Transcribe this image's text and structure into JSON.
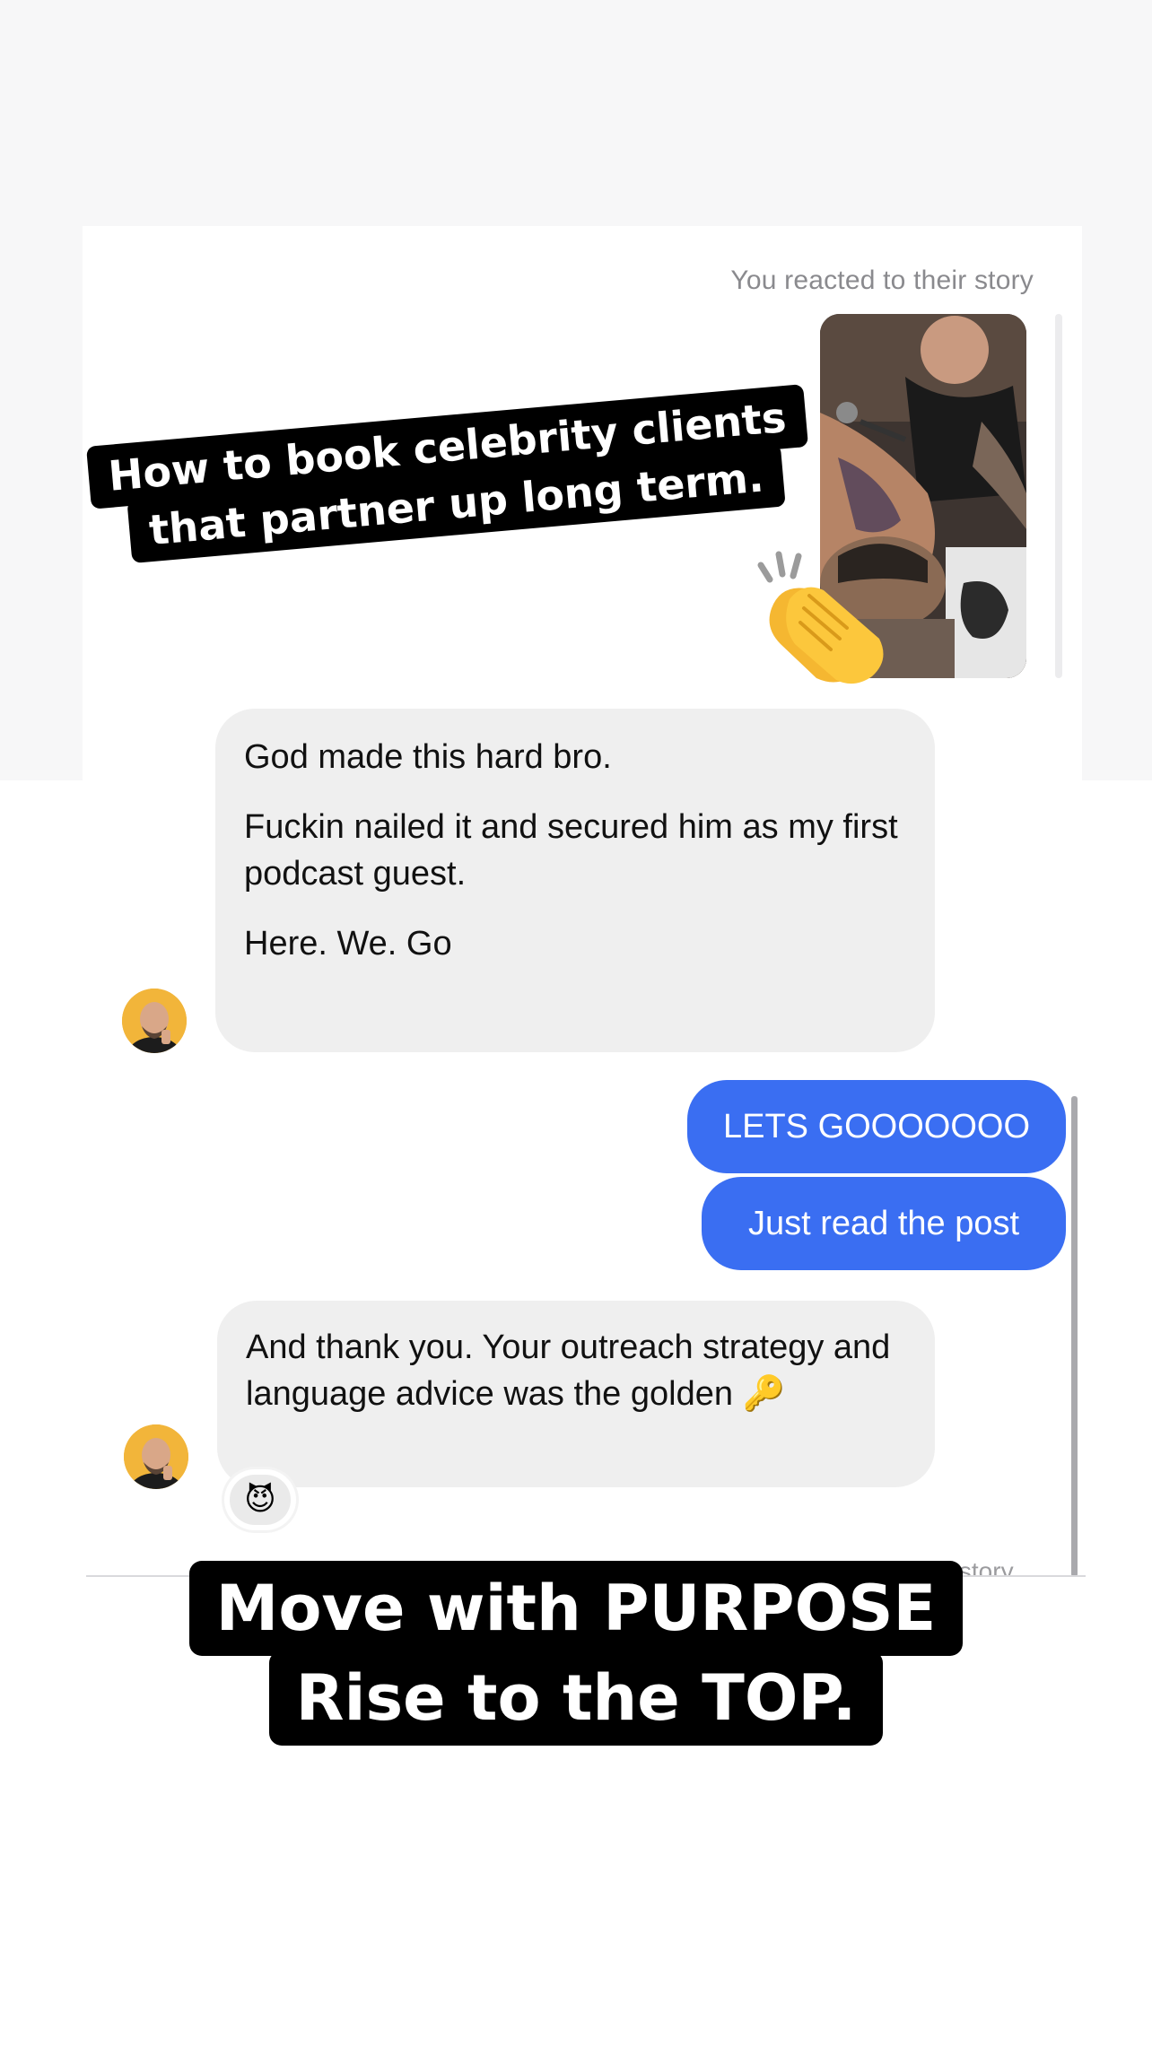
{
  "story": {
    "caption": "You reacted to their story",
    "thumbnail_icon": "tattoo-photo",
    "reaction_emoji": "👏"
  },
  "messages": {
    "m1": {
      "p1": "God made this hard bro.",
      "p2": "Fuckin nailed it and secured him as my first podcast guest.",
      "p3": "Here. We. Go"
    },
    "m2": "LETS GOOOOOOO",
    "m3": "Just read the post",
    "m4": {
      "text": "And thank you. Your outreach strategy and language advice was the golden",
      "emoji": "🔑",
      "reaction": "😈"
    }
  },
  "peek_text": "eir story",
  "overlay": {
    "headline_line1": "How to book celebrity clients",
    "headline_line2": "that partner up long term.",
    "tagline_line1": "Move with PURPOSE",
    "tagline_line2": "Rise to the TOP."
  },
  "colors": {
    "outgoing_bubble": "#3a6ef2",
    "incoming_bubble": "#efefef",
    "overlay_label": "#000000"
  }
}
